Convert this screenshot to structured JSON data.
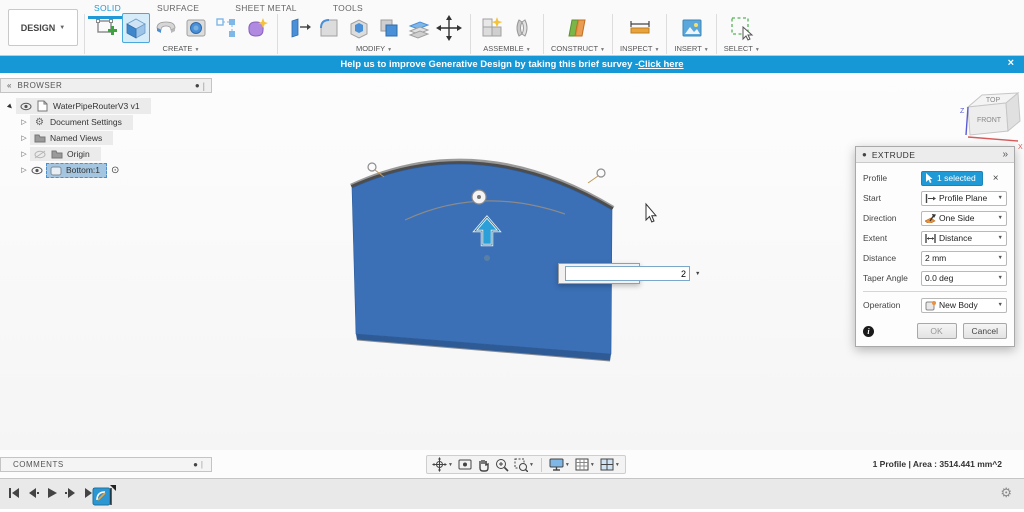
{
  "app": {
    "design_menu": "DESIGN",
    "tabs": [
      {
        "label": "SOLID",
        "active": true
      },
      {
        "label": "SURFACE",
        "active": false
      },
      {
        "label": "SHEET METAL",
        "active": false
      },
      {
        "label": "TOOLS",
        "active": false
      }
    ],
    "groups": {
      "create": "CREATE",
      "modify": "MODIFY",
      "assemble": "ASSEMBLE",
      "construct": "CONSTRUCT",
      "inspect": "INSPECT",
      "insert": "INSERT",
      "select": "SELECT"
    }
  },
  "banner": {
    "text": "Help us to improve Generative Design by taking this brief survey - ",
    "link": "Click here",
    "color": "#1697d6"
  },
  "browser": {
    "title": "BROWSER",
    "items": [
      {
        "label": "WaterPipeRouterV3 v1"
      },
      {
        "label": "Document Settings"
      },
      {
        "label": "Named Views"
      },
      {
        "label": "Origin"
      },
      {
        "label": "Bottom:1"
      }
    ]
  },
  "viewcube": {
    "top": "TOP",
    "front": "FRONT",
    "axis_z": "Z",
    "axis_x": "X"
  },
  "dialog": {
    "title": "EXTRUDE",
    "profile_label": "Profile",
    "profile_value": "1 selected",
    "start_label": "Start",
    "start_value": "Profile Plane",
    "direction_label": "Direction",
    "direction_value": "One Side",
    "extent_label": "Extent",
    "extent_value": "Distance",
    "distance_label": "Distance",
    "distance_value": "2 mm",
    "taper_label": "Taper Angle",
    "taper_value": "0.0 deg",
    "operation_label": "Operation",
    "operation_value": "New Body",
    "ok": "OK",
    "cancel": "Cancel",
    "info": "i"
  },
  "viewport": {
    "dimension_input": "2"
  },
  "statusbar": {
    "comments": "COMMENTS",
    "selection_info": "1 Profile | Area : 3514.441 mm^2"
  },
  "glyphs": {
    "caret": "▼",
    "dot": "●",
    "close": "×",
    "collapse": "«",
    "pin": "»",
    "radio": "⊙",
    "gear": "⚙",
    "root_marker": "▼",
    "child_marker": "▷",
    "bar": "|"
  },
  "colors": {
    "accent_blue": "#1f9ad6",
    "body_blue": "#3b6fb6",
    "banner_blue": "#1697d6",
    "selection_highlight": "#a5c6e0"
  }
}
